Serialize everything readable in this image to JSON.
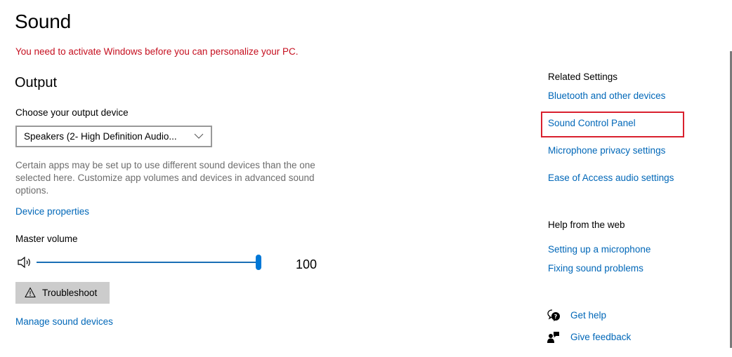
{
  "page": {
    "title": "Sound",
    "activation_warning": "You need to activate Windows before you can personalize your PC.",
    "colors": {
      "link": "#0067b8",
      "warning": "#c50f1f",
      "accent": "#0078d7",
      "highlight_box": "#d9202e",
      "button_bg": "#cccccc"
    }
  },
  "output": {
    "section_title": "Output",
    "device_label": "Choose your output device",
    "device_selected": "Speakers (2- High Definition Audio...",
    "device_chevron_icon": "chevron-down-icon",
    "help_text": "Certain apps may be set up to use different sound devices than the one selected here. Customize app volumes and devices in advanced sound options.",
    "device_properties_link": "Device properties",
    "master_volume_label": "Master volume",
    "volume_icon": "speaker-icon",
    "volume_value": "100",
    "volume_percent": 100,
    "troubleshoot_icon": "warning-icon",
    "troubleshoot_label": "Troubleshoot",
    "manage_devices_link": "Manage sound devices"
  },
  "sidebar": {
    "related_title": "Related Settings",
    "related_links": [
      "Bluetooth and other devices",
      "Sound Control Panel",
      "Microphone privacy settings",
      "Ease of Access audio settings"
    ],
    "highlighted_link": "Sound Control Panel",
    "web_title": "Help from the web",
    "web_links": [
      "Setting up a microphone",
      "Fixing sound problems"
    ],
    "get_help_icon": "get-help-icon",
    "get_help_label": "Get help",
    "feedback_icon": "feedback-icon",
    "feedback_label": "Give feedback"
  }
}
